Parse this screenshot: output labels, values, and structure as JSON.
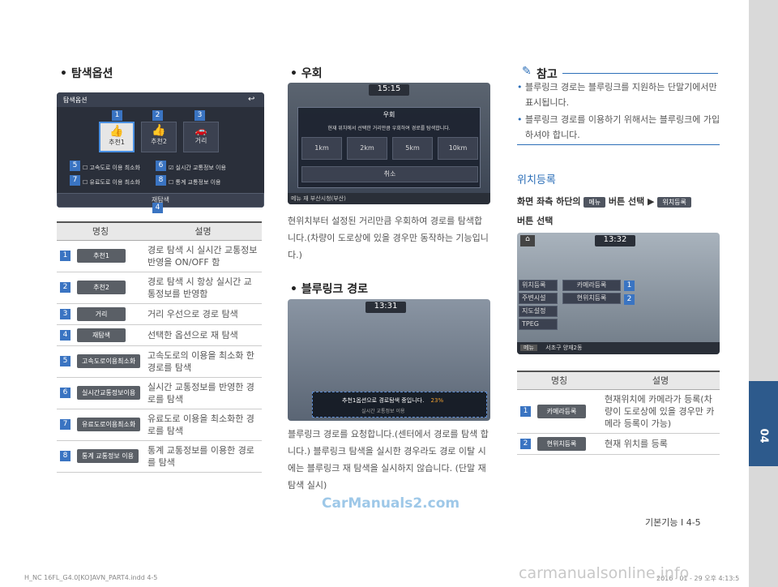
{
  "chapter": "04",
  "footer": {
    "page": "기본기능 I 4-5",
    "file": "H_NC 16FL_G4.0[KO]AVN_PART4.indd   4-5",
    "datetime": "2016 - 01 - 29   오후 4:13:5",
    "watermark1": "CarManuals2.com",
    "watermark2": "carmanualsonline.info"
  },
  "col1": {
    "title": "탐색옵션",
    "screen": {
      "header": "탐색옵션",
      "options": [
        "추천1",
        "추천2",
        "거리"
      ],
      "checks": [
        "고속도로 이용 최소화",
        "실시간 교통정보 이용",
        "유료도로 이용 최소화",
        "통계 교통정보 이용"
      ],
      "research": "재탐색",
      "nums": [
        "1",
        "2",
        "3",
        "4",
        "5",
        "6",
        "7",
        "8"
      ]
    },
    "table": {
      "headers": [
        "명칭",
        "설명"
      ],
      "rows": [
        {
          "num": "1",
          "chip": "추천1",
          "desc": "경로 탐색 시 실시간 교통정보 반영을 ON/OFF 함"
        },
        {
          "num": "2",
          "chip": "추천2",
          "desc": "경로 탐색 시 항상 실시간 교통정보를 반영함"
        },
        {
          "num": "3",
          "chip": "거리",
          "desc": "거리 우선으로 경로 탐색"
        },
        {
          "num": "4",
          "chip": "재탐색",
          "desc": "선택한 옵션으로 재 탐색"
        },
        {
          "num": "5",
          "chip": "고속도로이용최소화",
          "desc": "고속도로의 이용을 최소화 한 경로를 탐색"
        },
        {
          "num": "6",
          "chip": "실시간교통정보이용",
          "desc": "실시간 교통정보를 반영한 경로를 탐색"
        },
        {
          "num": "7",
          "chip": "유료도로이용최소화",
          "desc": "유료도로 이용을 최소화한 경로를 탐색"
        },
        {
          "num": "8",
          "chip": "통계 교통정보 이용",
          "desc": "통계 교통정보를 이용한 경로를 탐색"
        }
      ]
    }
  },
  "col2": {
    "detour": {
      "title": "우회",
      "screen": {
        "clock": "15:15",
        "dialog_title": "우회",
        "dialog_msg": "현재 위치에서 선택한 거리만큼 우회하여 경로를 탐색합니다.",
        "distances": [
          "1km",
          "2km",
          "5km",
          "10km"
        ],
        "cancel": "취소",
        "bottom": "메뉴  재 부산시청(부산)"
      },
      "text": "현위치부터 설정된 거리만큼 우회하여 경로를 탐색합니다.(차량이 도로상에 있을 경우만 동작하는 기능입니다.)"
    },
    "bluelink": {
      "title": "블루링크 경로",
      "screen": {
        "clock": "13:31",
        "msg": "추천1옵션으로 경로탐색 중입니다.",
        "pct": "23%",
        "sub": "실시간 교통정보 이용"
      },
      "text": "블루링크 경로를 요청합니다.(센터에서 경로를 탐색 합니다.) 블루링크 탐색을 실시한 경우라도 경로 이탈 시에는 블루링크 재 탐색을 실시하지 않습니다. (단말 재 탐색 실시)"
    }
  },
  "col3": {
    "note": {
      "title": "참고",
      "items": [
        "블루링크 경로는 블루링크를 지원하는 단말기에서만 표시됩니다.",
        "블루링크 경로를 이용하기 위해서는 블루링크에 가입하셔야 합니다."
      ]
    },
    "register": {
      "title": "위치등록",
      "instr_pre": "화면 좌측 하단의",
      "tag1": "메뉴",
      "instr_mid": "버튼 선택 ▶",
      "tag2": "위치등록",
      "instr_post": "버튼 선택",
      "screen": {
        "clock": "13:32",
        "menu": [
          "위치등록",
          "주변시설",
          "지도설정",
          "TPEG"
        ],
        "camera": "카메라등록",
        "current": "현위치등록",
        "bottom_menu": "메뉴",
        "address": "서초구 양재2동",
        "nums": [
          "1",
          "2"
        ]
      }
    },
    "table": {
      "headers": [
        "명칭",
        "설명"
      ],
      "rows": [
        {
          "num": "1",
          "chip": "카메라등록",
          "desc": "현재위치에 카메라가 등록(차량이 도로상에 있을 경우만 카메라 등록이 가능)"
        },
        {
          "num": "2",
          "chip": "현위치등록",
          "desc": "현재 위치를 등록"
        }
      ]
    }
  },
  "colors": {
    "accent": "#2d6fb8",
    "chip": "#5a5f66",
    "num": "#3a74c2",
    "strip": "#d9d9d9",
    "strip_active": "#2d5a8c"
  }
}
